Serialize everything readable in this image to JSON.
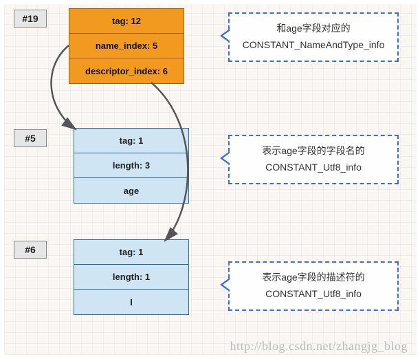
{
  "indices": {
    "i19": "#19",
    "i5": "#5",
    "i6": "#6"
  },
  "node19": {
    "tag": "tag: 12",
    "name_index": "name_index: 5",
    "descriptor_index": "descriptor_index: 6"
  },
  "node5": {
    "tag": "tag: 1",
    "length": "length: 3",
    "value": "age"
  },
  "node6": {
    "tag": "tag: 1",
    "length": "length: 1",
    "value": "I"
  },
  "callouts": {
    "c19_line1": "和age字段对应的",
    "c19_line2": "CONSTANT_NameAndType_info",
    "c5_line1": "表示age字段的字段名的",
    "c5_line2": "CONSTANT_Utf8_info",
    "c6_line1": "表示age字段的描述符的",
    "c6_line2": "CONSTANT_Utf8_info"
  },
  "watermark": "http://blog.csdn.net/zhangjg_blog",
  "chart_data": {
    "type": "table",
    "description": "Constant pool entries diagram",
    "entries": [
      {
        "index": 19,
        "type": "CONSTANT_NameAndType_info",
        "tag": 12,
        "name_index": 5,
        "descriptor_index": 6,
        "note": "和age字段对应的"
      },
      {
        "index": 5,
        "type": "CONSTANT_Utf8_info",
        "tag": 1,
        "length": 3,
        "bytes": "age",
        "note": "表示age字段的字段名的"
      },
      {
        "index": 6,
        "type": "CONSTANT_Utf8_info",
        "tag": 1,
        "length": 1,
        "bytes": "I",
        "note": "表示age字段的描述符的"
      }
    ],
    "arrows": [
      {
        "from": "#19.name_index",
        "to": "#5"
      },
      {
        "from": "#19.descriptor_index",
        "to": "#6"
      }
    ]
  }
}
